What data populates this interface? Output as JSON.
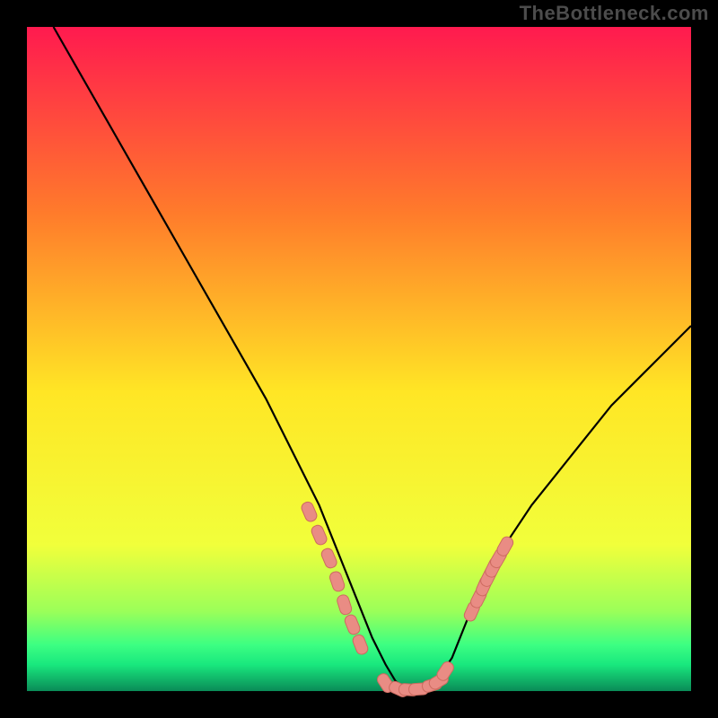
{
  "watermark": "TheBottleneck.com",
  "colors": {
    "black": "#000000",
    "curve": "#000000",
    "marker_fill": "#e98c84",
    "marker_stroke": "#cd6b60",
    "grad_top": "#ff1a4f",
    "grad_mid_upper": "#ff7b2b",
    "grad_mid": "#ffe625",
    "grad_lower": "#f1ff3b",
    "grad_green_band_top": "#9bff59",
    "grad_green_band_mid": "#3dff82",
    "grad_green_band_bot": "#19e87e",
    "grad_bottom": "#0a8b57"
  },
  "chart_data": {
    "type": "line",
    "title": "",
    "xlabel": "",
    "ylabel": "",
    "xlim": [
      0,
      100
    ],
    "ylim": [
      0,
      100
    ],
    "x": [
      4,
      8,
      12,
      16,
      20,
      24,
      28,
      32,
      36,
      38,
      40,
      42,
      44,
      46,
      48,
      50,
      52,
      54,
      55.5,
      57,
      58.5,
      60,
      62,
      64,
      66,
      68,
      72,
      76,
      80,
      84,
      88,
      92,
      96,
      100
    ],
    "values": [
      100,
      93,
      86,
      79,
      72,
      65,
      58,
      51,
      44,
      40,
      36,
      32,
      28,
      23,
      18,
      13,
      8,
      4,
      1.5,
      0.3,
      0.2,
      0.8,
      2.0,
      5,
      10,
      15,
      22,
      28,
      33,
      38,
      43,
      47,
      51,
      55
    ],
    "markers_x": [
      42.5,
      44.0,
      45.5,
      46.7,
      47.8,
      49.0,
      50.2,
      54.0,
      56.0,
      57.5,
      59.0,
      61.0,
      62.0,
      63.0,
      67.0,
      68.0,
      68.8,
      69.5,
      70.2,
      71.0,
      72.0
    ],
    "markers_y": [
      27.0,
      23.5,
      20.0,
      16.5,
      13.0,
      10.0,
      7.0,
      1.2,
      0.3,
      0.2,
      0.3,
      0.9,
      1.5,
      3.0,
      12.0,
      14.0,
      15.8,
      17.2,
      18.6,
      20.0,
      21.8
    ],
    "annotations": []
  }
}
